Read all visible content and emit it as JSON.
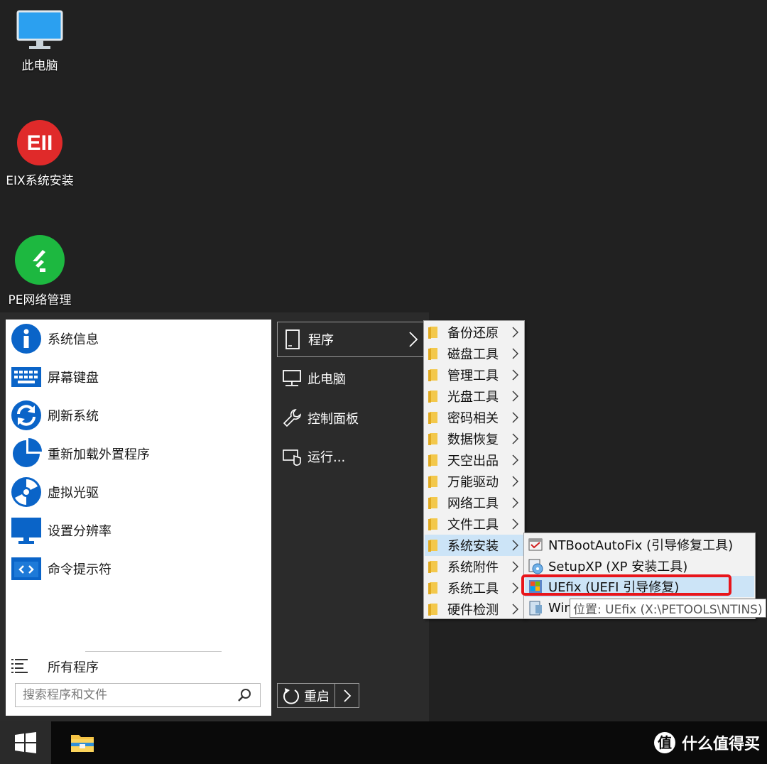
{
  "desktop": {
    "icons": [
      {
        "label": "此电脑",
        "icon": "monitor-icon"
      },
      {
        "label": "EIX系统安装",
        "icon": "eix-logo-icon",
        "logo_text": "EII"
      },
      {
        "label": "PE网络管理",
        "icon": "network-manager-icon"
      }
    ]
  },
  "start_menu": {
    "left_items": [
      {
        "label": "系统信息",
        "icon": "info-icon"
      },
      {
        "label": "屏幕键盘",
        "icon": "keyboard-icon"
      },
      {
        "label": "刷新系统",
        "icon": "refresh-icon"
      },
      {
        "label": "重新加载外置程序",
        "icon": "pie-chart-icon"
      },
      {
        "label": "虚拟光驱",
        "icon": "disc-icon"
      },
      {
        "label": "设置分辨率",
        "icon": "monitor-icon"
      },
      {
        "label": "命令提示符",
        "icon": "terminal-icon"
      }
    ],
    "all_programs": "所有程序",
    "search_placeholder": "搜索程序和文件",
    "right_items": [
      {
        "label": "程序",
        "icon": "document-icon"
      },
      {
        "label": "此电脑",
        "icon": "computer-icon"
      },
      {
        "label": "控制面板",
        "icon": "wrench-icon"
      },
      {
        "label": "运行...",
        "icon": "run-icon"
      }
    ],
    "restart_label": "重启"
  },
  "submenu_programs": {
    "items": [
      {
        "label": "备份还原"
      },
      {
        "label": "磁盘工具"
      },
      {
        "label": "管理工具"
      },
      {
        "label": "光盘工具"
      },
      {
        "label": "密码相关"
      },
      {
        "label": "数据恢复"
      },
      {
        "label": "天空出品"
      },
      {
        "label": "万能驱动"
      },
      {
        "label": "网络工具"
      },
      {
        "label": "文件工具"
      },
      {
        "label": "系统安装",
        "active": true
      },
      {
        "label": "系统附件"
      },
      {
        "label": "系统工具"
      },
      {
        "label": "硬件检测"
      }
    ]
  },
  "submenu_install": {
    "items": [
      {
        "label": "NTBootAutoFix (引导修复工具)",
        "icon": "ntbootautofix-icon"
      },
      {
        "label": "SetupXP (XP 安装工具)",
        "icon": "setupxp-icon"
      },
      {
        "label": "UEfix (UEFI 引导修复)",
        "icon": "uefix-icon",
        "highlighted": true
      },
      {
        "label": "Win",
        "icon": "wininstall-icon"
      }
    ],
    "tooltip": "位置: UEfix (X:\\PETOOLS\\NTINS)"
  },
  "taskbar": {
    "start_icon": "windows-logo-icon",
    "pinned": [
      {
        "icon": "file-explorer-icon"
      }
    ]
  },
  "watermark": {
    "text": "什么值得买",
    "icon": "smzdm-logo-icon"
  },
  "colors": {
    "desktop": "#212121",
    "menu_dark": "#2b2b2b",
    "accent_blue": "#0a64c8",
    "selection": "#cce4f7",
    "highlight_red": "#e8151b"
  }
}
